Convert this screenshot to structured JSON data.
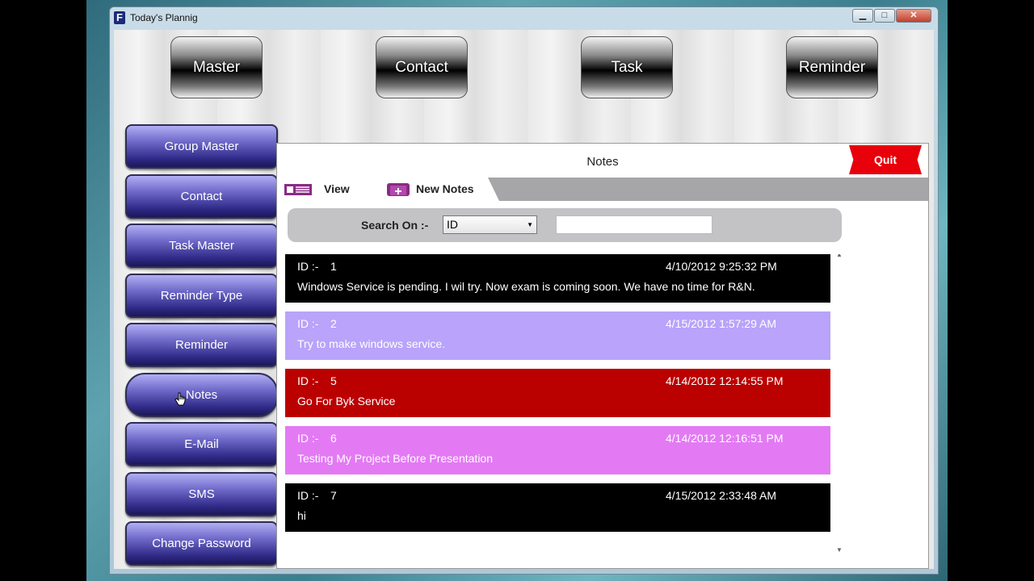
{
  "window": {
    "title": "Today's Plannig",
    "icon": "app-icon",
    "minimize": "▁",
    "maximize": "□",
    "close": "✕"
  },
  "top_nav": [
    {
      "label": "Master"
    },
    {
      "label": "Contact"
    },
    {
      "label": "Task"
    },
    {
      "label": "Reminder"
    }
  ],
  "sidebar": [
    {
      "label": "Group Master"
    },
    {
      "label": "Contact"
    },
    {
      "label": "Task Master"
    },
    {
      "label": "Reminder Type"
    },
    {
      "label": "Reminder"
    },
    {
      "label": "Notes",
      "active": true
    },
    {
      "label": "E-Mail"
    },
    {
      "label": "SMS"
    },
    {
      "label": "Change Password"
    }
  ],
  "panel": {
    "title": "Notes",
    "quit_label": "Quit",
    "tabs": [
      {
        "label": "View",
        "icon": "view-list-icon"
      },
      {
        "label": "New Notes",
        "icon": "add-note-icon"
      }
    ],
    "search": {
      "label": "Search On :-",
      "selected": "ID",
      "value": ""
    }
  },
  "notes": [
    {
      "id_label": "ID :-",
      "id": "1",
      "timestamp": "4/10/2012 9:25:32 PM",
      "text": "Windows Service is pending.  I wil try.  Now  exam is coming soon. We have no time for R&N.",
      "bg": "#000000",
      "fg": "#ffffff"
    },
    {
      "id_label": "ID :-",
      "id": "2",
      "timestamp": "4/15/2012 1:57:29 AM",
      "text": "Try to make windows service.",
      "bg": "#b9a3fb",
      "fg": "#ffffff"
    },
    {
      "id_label": "ID :-",
      "id": "5",
      "timestamp": "4/14/2012 12:14:55 PM",
      "text": "Go For Byk Service",
      "bg": "#bb0000",
      "fg": "#ffffff"
    },
    {
      "id_label": "ID :-",
      "id": "6",
      "timestamp": "4/14/2012 12:16:51 PM",
      "text": "Testing My Project Before Presentation",
      "bg": "#e37af4",
      "fg": "#ffffff"
    },
    {
      "id_label": "ID :-",
      "id": "7",
      "timestamp": "4/15/2012 2:33:48 AM",
      "text": "hi",
      "bg": "#000000",
      "fg": "#ffffff"
    }
  ]
}
